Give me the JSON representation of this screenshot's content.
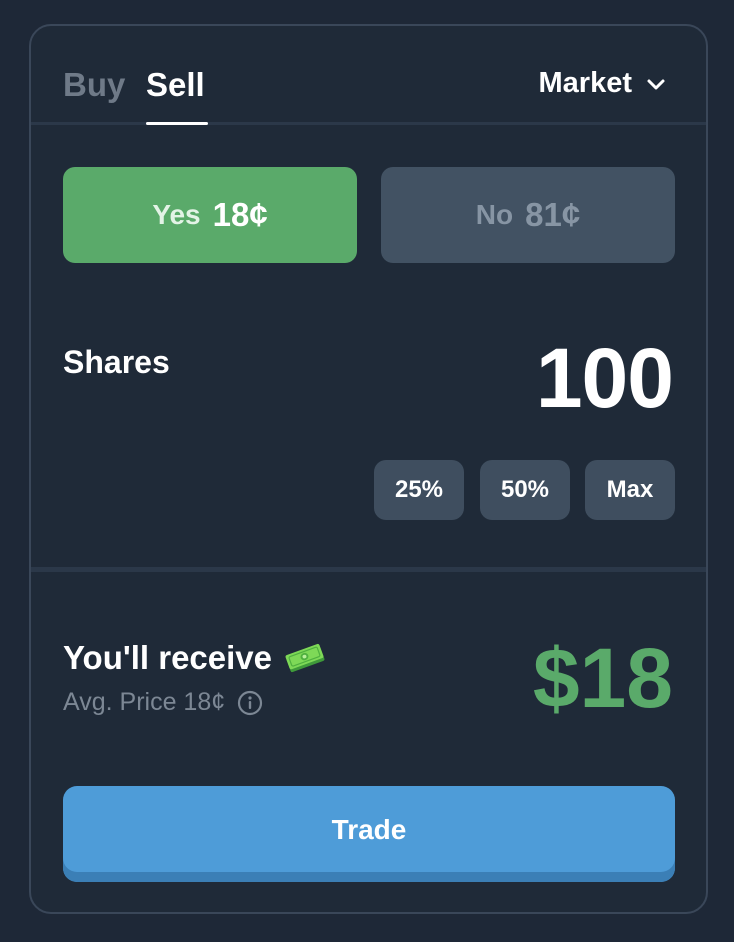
{
  "tabs": {
    "buy_label": "Buy",
    "sell_label": "Sell",
    "active": "Sell"
  },
  "order_type": {
    "selected": "Market",
    "icon": "chevron-down-icon"
  },
  "outcomes": {
    "yes": {
      "label": "Yes",
      "price": "18¢",
      "selected": true,
      "color": "#5aaa6a"
    },
    "no": {
      "label": "No",
      "price": "81¢",
      "selected": false,
      "color": "#425263"
    }
  },
  "shares": {
    "label": "Shares",
    "value": "100",
    "quick_buttons": [
      "25%",
      "50%",
      "Max"
    ]
  },
  "receive": {
    "label": "You'll receive",
    "icon": "money-icon",
    "avg_price_label": "Avg. Price 18¢",
    "info_icon": "info-icon",
    "amount": "$18",
    "amount_color": "#5aaa6a"
  },
  "trade": {
    "label": "Trade",
    "color": "#4e9cd8"
  }
}
